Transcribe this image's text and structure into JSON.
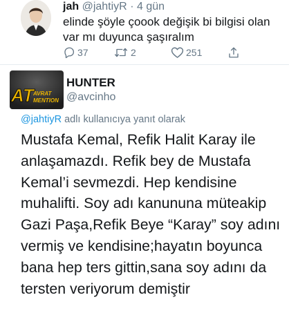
{
  "tweet1": {
    "display_name": "jah",
    "handle": "@jahtiyR",
    "separator": "·",
    "time": "4 gün",
    "text": "elinde şöyle çoook değişik bi bilgisi olan var mı duyunca şaşıralım",
    "actions": {
      "reply_count": "37",
      "retweet_count": "2",
      "like_count": "251"
    }
  },
  "tweet2": {
    "display_name": "HUNTER",
    "handle": "@avcinho",
    "avatar_text": {
      "big": "AT",
      "small_top": "AVRAT",
      "small_bottom": "MENTION"
    },
    "reply_to": {
      "mention": "@jahtiyR",
      "rest": "adlı kullanıcıya yanıt olarak"
    },
    "body_lines": [
      "Mustafa Kemal, Refik Halit Karay ile",
      "anlaşamazdı. Refik bey de Mustafa",
      "Kemal’i sevmezdi. Hep kendisine",
      "muhalifti. Soy adı kanununa müteakip",
      "Gazi Paşa,Refik Beye “Karay” soy adını",
      "vermiş ve kendisine;hayatın boyunca",
      "bana hep ters gittin,sana soy adını da",
      "tersten veriyorum demiştir"
    ]
  },
  "colors": {
    "text": "#14171a",
    "secondary": "#657786",
    "link": "#1b95e0",
    "divider": "#e6ecf0",
    "avatar_logo": "#e9b300"
  },
  "icons": [
    "reply-icon",
    "retweet-icon",
    "like-icon",
    "share-icon"
  ]
}
